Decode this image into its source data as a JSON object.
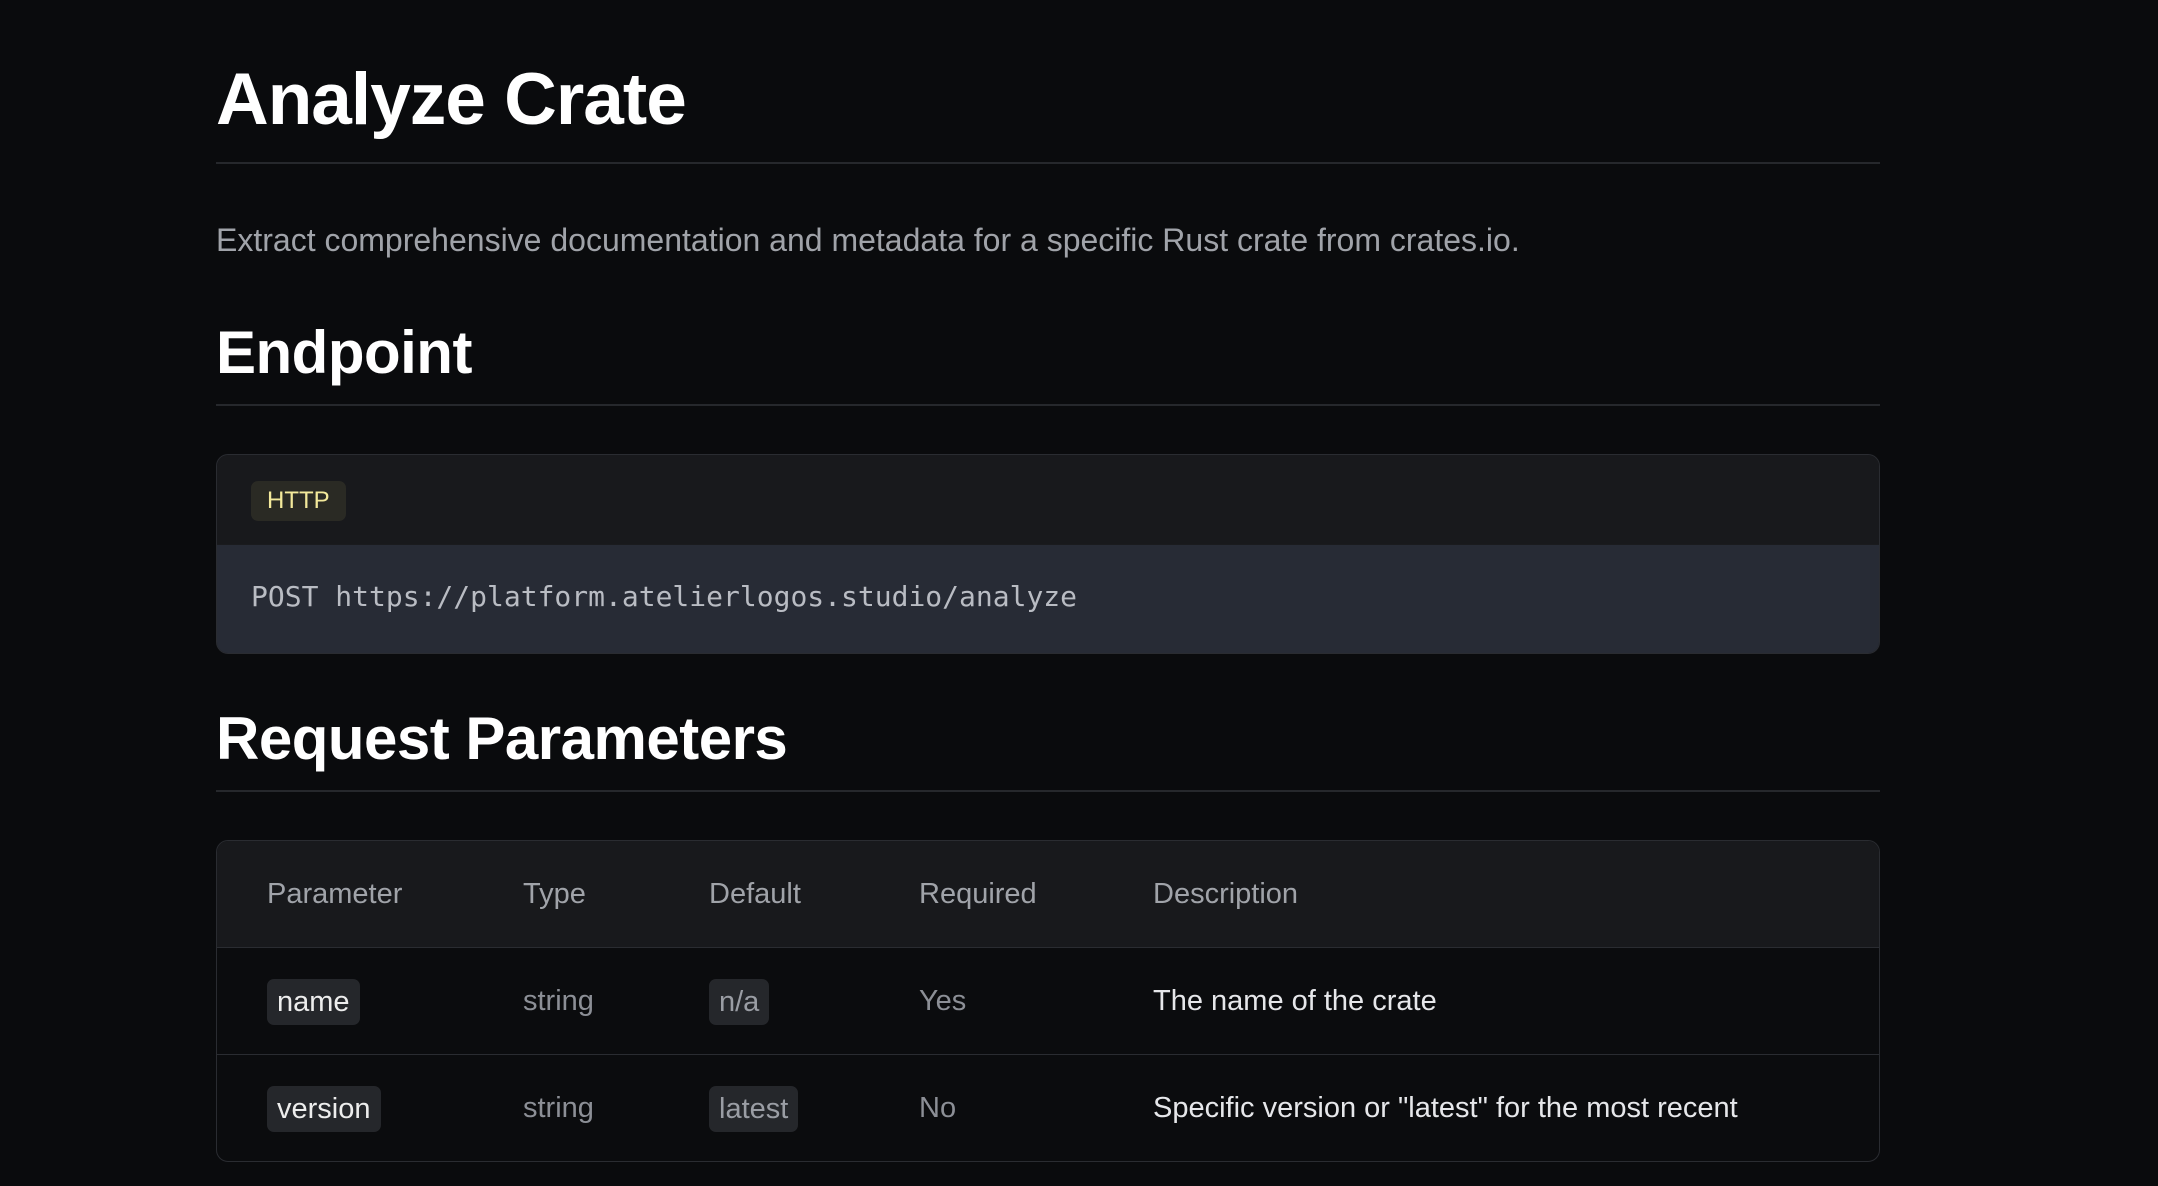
{
  "page": {
    "title": "Analyze Crate",
    "lead": "Extract comprehensive documentation and metadata for a specific Rust crate from crates.io."
  },
  "endpoint": {
    "heading": "Endpoint",
    "language": "HTTP",
    "code": "POST https://platform.atelierlogos.studio/analyze"
  },
  "params": {
    "heading": "Request Parameters",
    "columns": [
      "Parameter",
      "Type",
      "Default",
      "Required",
      "Description"
    ],
    "rows": [
      {
        "parameter": "name",
        "type": "string",
        "default": "n/a",
        "required": "Yes",
        "description": "The name of the crate"
      },
      {
        "parameter": "version",
        "type": "string",
        "default": "latest",
        "required": "No",
        "description": "Specific version or \"latest\" for the most recent"
      }
    ]
  },
  "colors": {
    "background": "#0a0b0d",
    "badge_text": "#f3e99b",
    "code_bg": "#272b35"
  }
}
